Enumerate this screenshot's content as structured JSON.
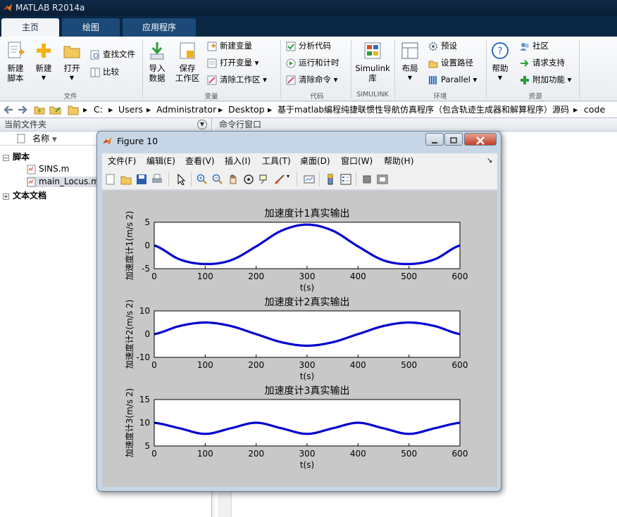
{
  "app": {
    "title": "MATLAB R2014a"
  },
  "tabs": [
    {
      "label": "主页"
    },
    {
      "label": "绘图"
    },
    {
      "label": "应用程序"
    }
  ],
  "ribbon": {
    "new_script": "新建\n脚本",
    "new": "新建",
    "open": "打开",
    "find_files": "查找文件",
    "compare": "比较",
    "import_data": "导入\n数据",
    "save_workspace": "保存\n工作区",
    "new_variable": "新建变量",
    "open_variable": "打开变量",
    "clear_workspace": "清除工作区",
    "analyze_code": "分析代码",
    "run_and_time": "运行和计时",
    "clear_commands": "清除命令",
    "simulink": "Simulink\n库",
    "layout": "布局",
    "preferences": "预设",
    "set_path": "设置路径",
    "parallel": "Parallel",
    "help": "帮助",
    "community": "社区",
    "request_support": "请求支持",
    "addons": "附加功能",
    "groups": {
      "file": "文件",
      "variable": "变量",
      "code": "代码",
      "simulink": "SIMULINK",
      "environment": "环境",
      "resources": "资源"
    }
  },
  "address": {
    "crumbs": [
      "C:",
      "Users",
      "Administrator",
      "Desktop",
      "基于matlab编程纯捷联惯性导航仿真程序（包含轨迹生成器和解算程序）源码",
      "code"
    ]
  },
  "left_pane": {
    "title": "当前文件夹",
    "column_header": "名称",
    "tree": {
      "scripts_group": "脚本",
      "file1": "SINS.m",
      "file2": "main_Locus.m",
      "text_group": "文本文档"
    }
  },
  "right_pane": {
    "title": "命令行窗口"
  },
  "figure": {
    "title": "Figure 10",
    "menu": [
      "文件(F)",
      "编辑(E)",
      "查看(V)",
      "插入(I)",
      "工具(T)",
      "桌面(D)",
      "窗口(W)",
      "帮助(H)"
    ]
  },
  "colors": {
    "line": "#0000d0",
    "plot_bg": "#ffffff",
    "figure_bg": "#c8c8c8"
  },
  "chart_data": [
    {
      "type": "line",
      "title": "加速度计1真实输出",
      "xlabel": "t(s)",
      "ylabel": "加速度计1(m/s 2)",
      "xlim": [
        0,
        600
      ],
      "ylim": [
        -5,
        5
      ],
      "xticks": [
        0,
        100,
        200,
        300,
        400,
        500,
        600
      ],
      "yticks": [
        -5,
        0,
        5
      ],
      "x": [
        0,
        50,
        100,
        150,
        200,
        250,
        300,
        350,
        400,
        450,
        500,
        550,
        600
      ],
      "y": [
        0,
        -3.0,
        -4.0,
        -3.2,
        -0.2,
        3.2,
        4.5,
        3.2,
        -0.2,
        -3.2,
        -4.0,
        -3.0,
        0
      ],
      "grid": false
    },
    {
      "type": "line",
      "title": "加速度计2真实输出",
      "xlabel": "t(s)",
      "ylabel": "加速度计2(m/s 2)",
      "xlim": [
        0,
        600
      ],
      "ylim": [
        -10,
        10
      ],
      "xticks": [
        0,
        100,
        200,
        300,
        400,
        500,
        600
      ],
      "yticks": [
        -10,
        0,
        10
      ],
      "x": [
        0,
        50,
        100,
        150,
        200,
        250,
        300,
        350,
        400,
        450,
        500,
        550,
        600
      ],
      "y": [
        0,
        3.5,
        5,
        3.5,
        0,
        -3.5,
        -5,
        -3.5,
        0,
        3.5,
        5,
        3.5,
        0
      ],
      "grid": false
    },
    {
      "type": "line",
      "title": "加速度计3真实输出",
      "xlabel": "t(s)",
      "ylabel": "加速度计3(m/s 2)",
      "xlim": [
        0,
        600
      ],
      "ylim": [
        5,
        15
      ],
      "xticks": [
        0,
        100,
        200,
        300,
        400,
        500,
        600
      ],
      "yticks": [
        5,
        10,
        15
      ],
      "x": [
        0,
        50,
        100,
        150,
        200,
        250,
        300,
        350,
        400,
        450,
        500,
        550,
        600
      ],
      "y": [
        10,
        8.8,
        7.6,
        8.8,
        10,
        8.8,
        7.6,
        8.8,
        10,
        8.8,
        7.6,
        8.8,
        10
      ],
      "grid": false
    }
  ]
}
